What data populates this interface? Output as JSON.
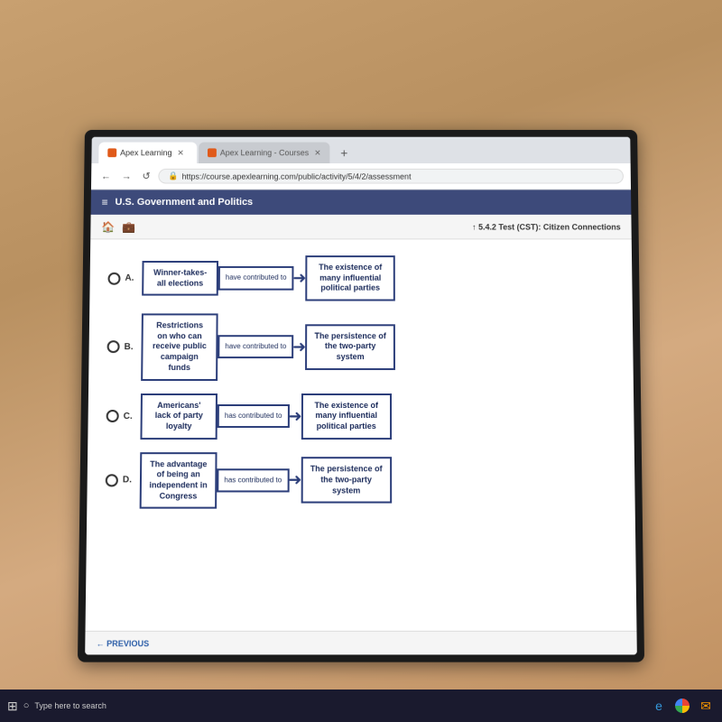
{
  "browser": {
    "tabs": [
      {
        "label": "Apex Learning",
        "active": true,
        "favicon": "A"
      },
      {
        "label": "Apex Learning - Courses",
        "active": false,
        "favicon": "A"
      }
    ],
    "url": "https://course.apexlearning.com/public/activity/5/4/2/assessment"
  },
  "app": {
    "title": "U.S. Government and Politics",
    "breadcrumb_prefix": "5.4.2 Test (CST):",
    "breadcrumb_suffix": "Citizen Connections"
  },
  "options": [
    {
      "letter": "A",
      "cause": "Winner-takes-all elections",
      "connector": "have contributed to",
      "effect": "The existence of many influential political parties"
    },
    {
      "letter": "B",
      "cause": "Restrictions on who can receive public campaign funds",
      "connector": "have contributed to",
      "effect": "The persistence of the two-party system"
    },
    {
      "letter": "C",
      "cause": "Americans' lack of party loyalty",
      "connector": "has contributed to",
      "effect": "The existence of many influential political parties"
    },
    {
      "letter": "D",
      "cause": "The advantage of being an independent in Congress",
      "connector": "has contributed to",
      "effect": "The persistence of the two-party system"
    }
  ],
  "navigation": {
    "prev_label": "← PREVIOUS"
  },
  "taskbar": {
    "search_placeholder": "Type here to search"
  }
}
